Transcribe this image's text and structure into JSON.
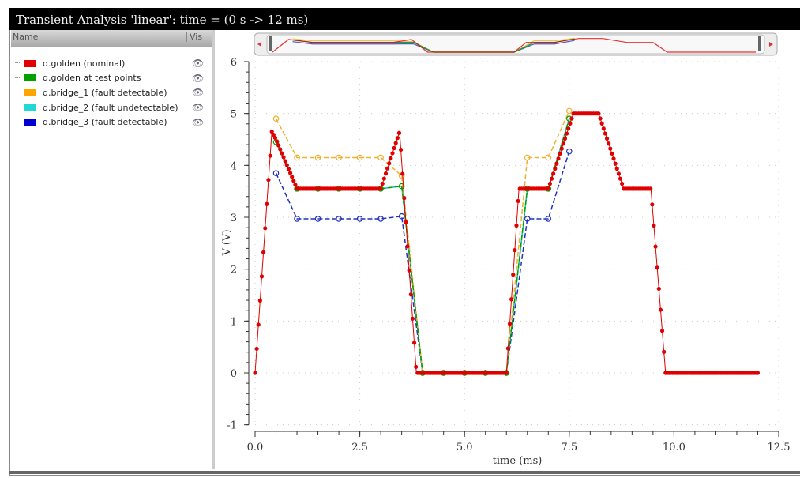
{
  "window": {
    "title": "Transient Analysis 'linear': time = (0 s -> 12 ms)"
  },
  "legend_panel": {
    "col_name": "Name",
    "col_vis": "Vis",
    "items": [
      {
        "label": "d.golden (nominal)",
        "color": "#e00000"
      },
      {
        "label": "d.golden at test points",
        "color": "#00a000"
      },
      {
        "label": "d.bridge_1 (fault detectable)",
        "color": "#ffa500"
      },
      {
        "label": "d.bridge_2 (fault undetectable)",
        "color": "#20d8d8"
      },
      {
        "label": "d.bridge_3 (fault detectable)",
        "color": "#0000d0"
      }
    ]
  },
  "chart_data": {
    "type": "line",
    "xlabel": "time (ms)",
    "ylabel": "V (V)",
    "xlim": [
      0,
      12.5
    ],
    "ylim": [
      -1,
      6
    ],
    "xticks": [
      "0.0",
      "2.5",
      "5.0",
      "7.5",
      "10.0",
      "12.5"
    ],
    "yticks": [
      "-1",
      "0",
      "1",
      "2",
      "3",
      "4",
      "5",
      "6"
    ],
    "grid": true,
    "series": [
      {
        "name": "d.golden (nominal)",
        "color": "#e00000",
        "style": "solid-dense-markers",
        "x": [
          0,
          0.4,
          0.5,
          1.0,
          3.0,
          3.45,
          3.85,
          6.0,
          6.3,
          7.0,
          7.6,
          8.2,
          8.8,
          9.45,
          9.8,
          12.0
        ],
        "y": [
          0,
          4.65,
          4.5,
          3.55,
          3.55,
          4.65,
          0,
          0,
          3.55,
          3.55,
          5.0,
          5.0,
          3.55,
          3.55,
          0,
          0
        ]
      },
      {
        "name": "d.golden at test points",
        "color": "#00a000",
        "style": "dashed",
        "x": [
          0.5,
          1,
          1.5,
          2,
          2.5,
          3,
          3.5,
          4,
          4.5,
          5,
          5.5,
          6,
          6.5,
          7,
          7.5
        ],
        "y": [
          4.45,
          3.55,
          3.55,
          3.55,
          3.55,
          3.55,
          3.6,
          0,
          0,
          0,
          0,
          0,
          3.55,
          3.55,
          4.9
        ]
      },
      {
        "name": "d.bridge_1 (fault detectable)",
        "color": "#f0b030",
        "style": "dashed",
        "x": [
          0.5,
          1,
          1.5,
          2,
          2.5,
          3,
          3.5,
          4,
          4.5,
          5,
          5.5,
          6,
          6.5,
          7,
          7.5
        ],
        "y": [
          4.9,
          4.15,
          4.15,
          4.15,
          4.15,
          4.15,
          3.8,
          0,
          0,
          0,
          0,
          0,
          4.15,
          4.15,
          5.05
        ]
      },
      {
        "name": "d.bridge_2 (fault undetectable)",
        "color": "#20b8b8",
        "style": "solid",
        "x": [
          0.5,
          1,
          1.5,
          2,
          2.5,
          3,
          3.5,
          4,
          4.5,
          5,
          5.5,
          6,
          6.5,
          7,
          7.5
        ],
        "y": [
          4.45,
          3.55,
          3.55,
          3.55,
          3.55,
          3.55,
          3.6,
          0,
          0,
          0,
          0,
          0,
          3.55,
          3.55,
          4.9
        ]
      },
      {
        "name": "d.bridge_3 (fault detectable)",
        "color": "#2030c0",
        "style": "dashed",
        "x": [
          0.5,
          1,
          1.5,
          2,
          2.5,
          3,
          3.5,
          4,
          4.5,
          5,
          5.5,
          6,
          6.5,
          7,
          7.5
        ],
        "y": [
          3.85,
          2.97,
          2.97,
          2.97,
          2.97,
          2.97,
          3.02,
          0,
          0,
          0,
          0,
          0,
          2.97,
          2.97,
          4.27
        ]
      }
    ]
  }
}
